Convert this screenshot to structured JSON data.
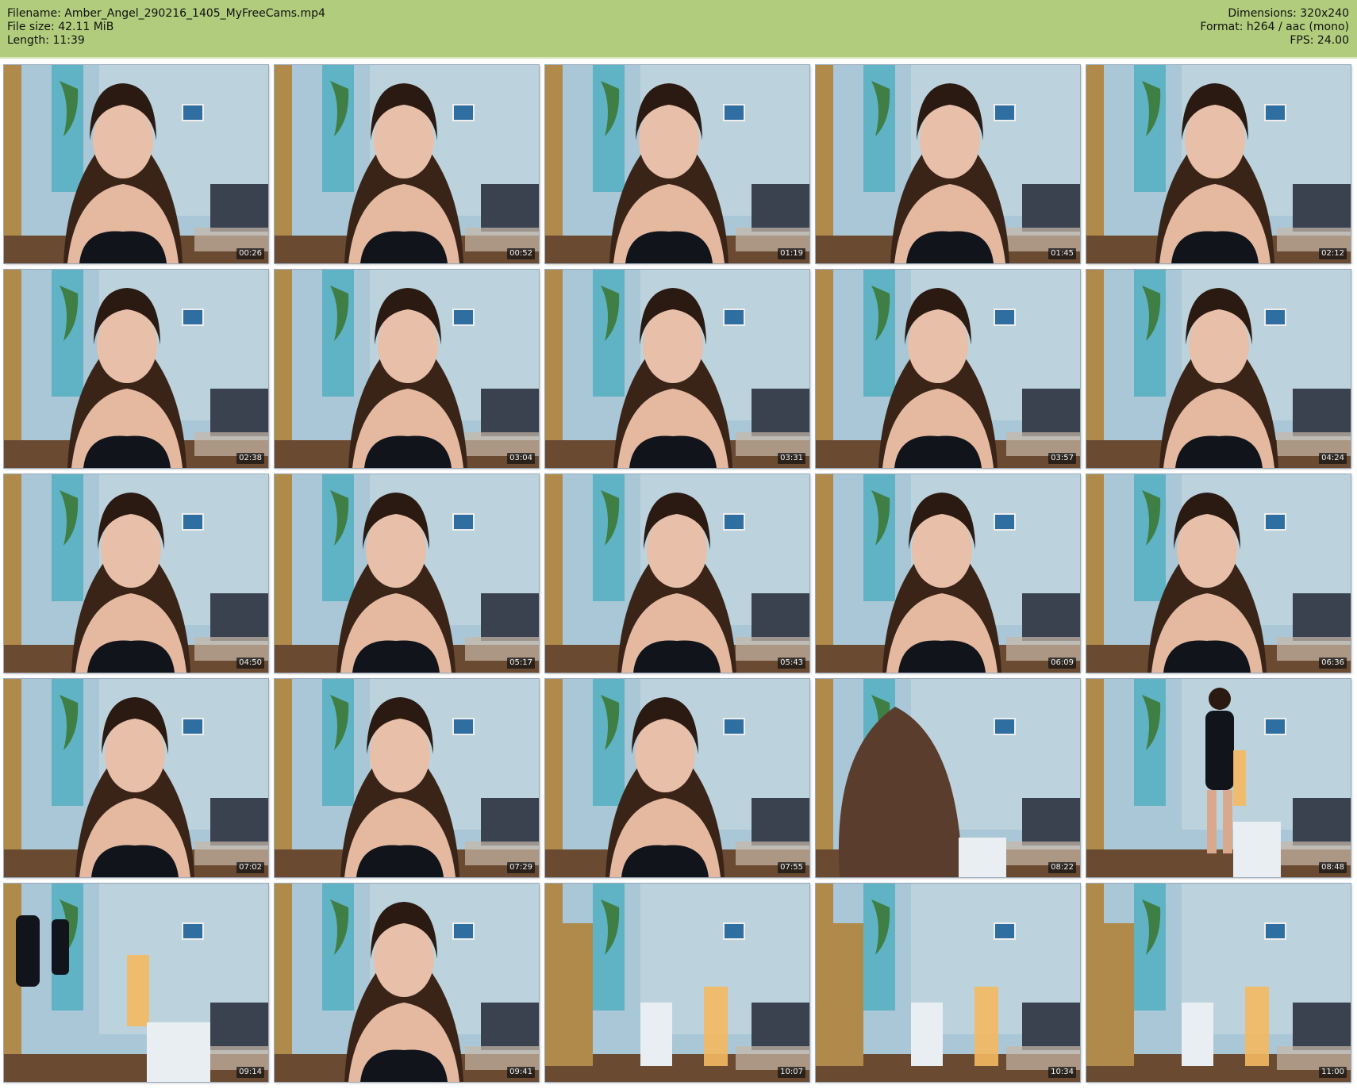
{
  "header": {
    "filename_label": "Filename: Amber_Angel_290216_1405_MyFreeCams.mp4",
    "filesize_label": "File size: 42.11 MiB",
    "length_label": "Length: 11:39",
    "dimensions_label": "Dimensions: 320x240",
    "format_label": "Format: h264 / aac (mono)",
    "fps_label": "FPS: 24.00"
  },
  "colors": {
    "header_bg": "#b0cc7c",
    "timestamp_bg": "#141414",
    "timestamp_text": "#f2f2f2"
  },
  "thumbnails": [
    {
      "time": "00:26",
      "scene": "seated"
    },
    {
      "time": "00:52",
      "scene": "seated"
    },
    {
      "time": "01:19",
      "scene": "seated"
    },
    {
      "time": "01:45",
      "scene": "seated"
    },
    {
      "time": "02:12",
      "scene": "seated"
    },
    {
      "time": "02:38",
      "scene": "seated"
    },
    {
      "time": "03:04",
      "scene": "seated"
    },
    {
      "time": "03:31",
      "scene": "seated"
    },
    {
      "time": "03:57",
      "scene": "seated"
    },
    {
      "time": "04:24",
      "scene": "seated"
    },
    {
      "time": "04:50",
      "scene": "seated"
    },
    {
      "time": "05:17",
      "scene": "seated"
    },
    {
      "time": "05:43",
      "scene": "seated"
    },
    {
      "time": "06:09",
      "scene": "seated"
    },
    {
      "time": "06:36",
      "scene": "seated"
    },
    {
      "time": "07:02",
      "scene": "seated"
    },
    {
      "time": "07:29",
      "scene": "seated"
    },
    {
      "time": "07:55",
      "scene": "seated"
    },
    {
      "time": "08:22",
      "scene": "hair"
    },
    {
      "time": "08:48",
      "scene": "standing"
    },
    {
      "time": "09:14",
      "scene": "standing-far"
    },
    {
      "time": "09:41",
      "scene": "closeup"
    },
    {
      "time": "10:07",
      "scene": "empty"
    },
    {
      "time": "10:34",
      "scene": "empty"
    },
    {
      "time": "11:00",
      "scene": "empty"
    }
  ]
}
